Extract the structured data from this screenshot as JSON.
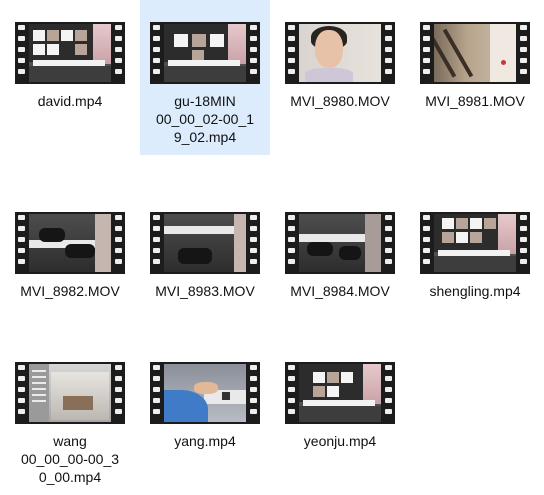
{
  "files": [
    {
      "name": "david.mp4",
      "selected": false,
      "thumb": "room-pictures"
    },
    {
      "name": "gu-18MIN\n00_00_02-00_1\n9_02.mp4",
      "selected": true,
      "thumb": "room-pictures"
    },
    {
      "name": "MVI_8980.MOV",
      "selected": false,
      "thumb": "face"
    },
    {
      "name": "MVI_8981.MOV",
      "selected": false,
      "thumb": "stairs"
    },
    {
      "name": "MVI_8982.MOV",
      "selected": false,
      "thumb": "rotated"
    },
    {
      "name": "MVI_8983.MOV",
      "selected": false,
      "thumb": "rotated"
    },
    {
      "name": "MVI_8984.MOV",
      "selected": false,
      "thumb": "rotated"
    },
    {
      "name": "shengling.mp4",
      "selected": false,
      "thumb": "room-pictures"
    },
    {
      "name": "wang\n00_00_00-00_3\n0_00.mp4",
      "selected": false,
      "thumb": "office"
    },
    {
      "name": "yang.mp4",
      "selected": false,
      "thumb": "hand"
    },
    {
      "name": "yeonju.mp4",
      "selected": false,
      "thumb": "room-pictures"
    }
  ],
  "colors": {
    "selection_background": "#dcecfc",
    "film_strip": "#1c1c1c",
    "label_text": "#111111"
  }
}
